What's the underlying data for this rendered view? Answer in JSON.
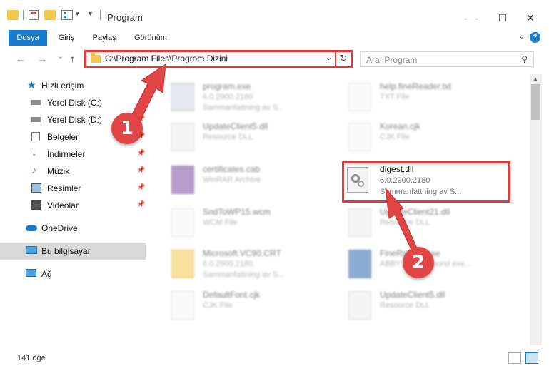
{
  "window": {
    "title": "Program",
    "minimize": "—",
    "maximize": "☐",
    "close": "✕"
  },
  "ribbon": {
    "tabs": [
      "Dosya",
      "Giriş",
      "Paylaş",
      "Görünüm"
    ],
    "help": "?"
  },
  "nav": {
    "back": "←",
    "forward": "→",
    "recent": "⌄",
    "up": "↑"
  },
  "address": {
    "path": "C:\\Program Files\\Program Dizini",
    "dropdown": "⌄",
    "refresh": "↻"
  },
  "search": {
    "placeholder": "Ara: Program",
    "icon": "search-icon"
  },
  "sidebar": {
    "items": [
      {
        "label": "Hızlı erişim",
        "icon": "star-icon",
        "pinned": false
      },
      {
        "label": "Yerel Disk (C:)",
        "icon": "drive-icon",
        "pinned": false
      },
      {
        "label": "Yerel Disk (D:)",
        "icon": "drive-icon",
        "pinned": true
      },
      {
        "label": "Belgeler",
        "icon": "documents-icon",
        "pinned": true
      },
      {
        "label": "İndirmeler",
        "icon": "download-icon",
        "pinned": true
      },
      {
        "label": "Müzik",
        "icon": "music-icon",
        "pinned": true
      },
      {
        "label": "Resimler",
        "icon": "pictures-icon",
        "pinned": true
      },
      {
        "label": "Videolar",
        "icon": "videos-icon",
        "pinned": true
      },
      {
        "label": "OneDrive",
        "icon": "cloud-icon",
        "pinned": false
      },
      {
        "label": "Bu bilgisayar",
        "icon": "computer-icon",
        "pinned": false,
        "selected": true
      },
      {
        "label": "Ağ",
        "icon": "network-icon",
        "pinned": false
      }
    ]
  },
  "files": {
    "left": [
      {
        "name": "program.exe",
        "line1": "6.0.2900.2180",
        "line2": "Sammanfattning av S..."
      },
      {
        "name": "UpdateClient5.dll",
        "line1": "Resource DLL"
      },
      {
        "name": "certificates.cab",
        "line1": "WinRAR Archive"
      },
      {
        "name": "SndToWP15.wcm",
        "line1": "WCM File"
      },
      {
        "name": "Microsoft.VC90.CRT",
        "line1": "6.0.2900.2180",
        "line2": "Sammanfattning av S..."
      },
      {
        "name": "DefaultFont.cjk",
        "line1": "CJK File"
      }
    ],
    "right": [
      {
        "name": "help.fineReader.txt",
        "line1": "TXT File"
      },
      {
        "name": "Korean.cjk",
        "line1": "CJK File"
      },
      {
        "name": "digest.dll",
        "line1": "6.0.2900.2180",
        "line2": "Sammanfattning av S..."
      },
      {
        "name": "UpdateClient21.dll",
        "line1": "Resource DLL"
      },
      {
        "name": "FineReader.exe",
        "line1": "ABBYY Background exe..."
      },
      {
        "name": "UpdateClient5.dll",
        "line1": "Resource DLL"
      }
    ]
  },
  "annotations": {
    "step1": "1",
    "step2": "2",
    "color": "#e24545"
  },
  "status": {
    "count": "141 öğe"
  },
  "colors": {
    "accent": "#1979ca",
    "highlight": "#e03a3a"
  }
}
